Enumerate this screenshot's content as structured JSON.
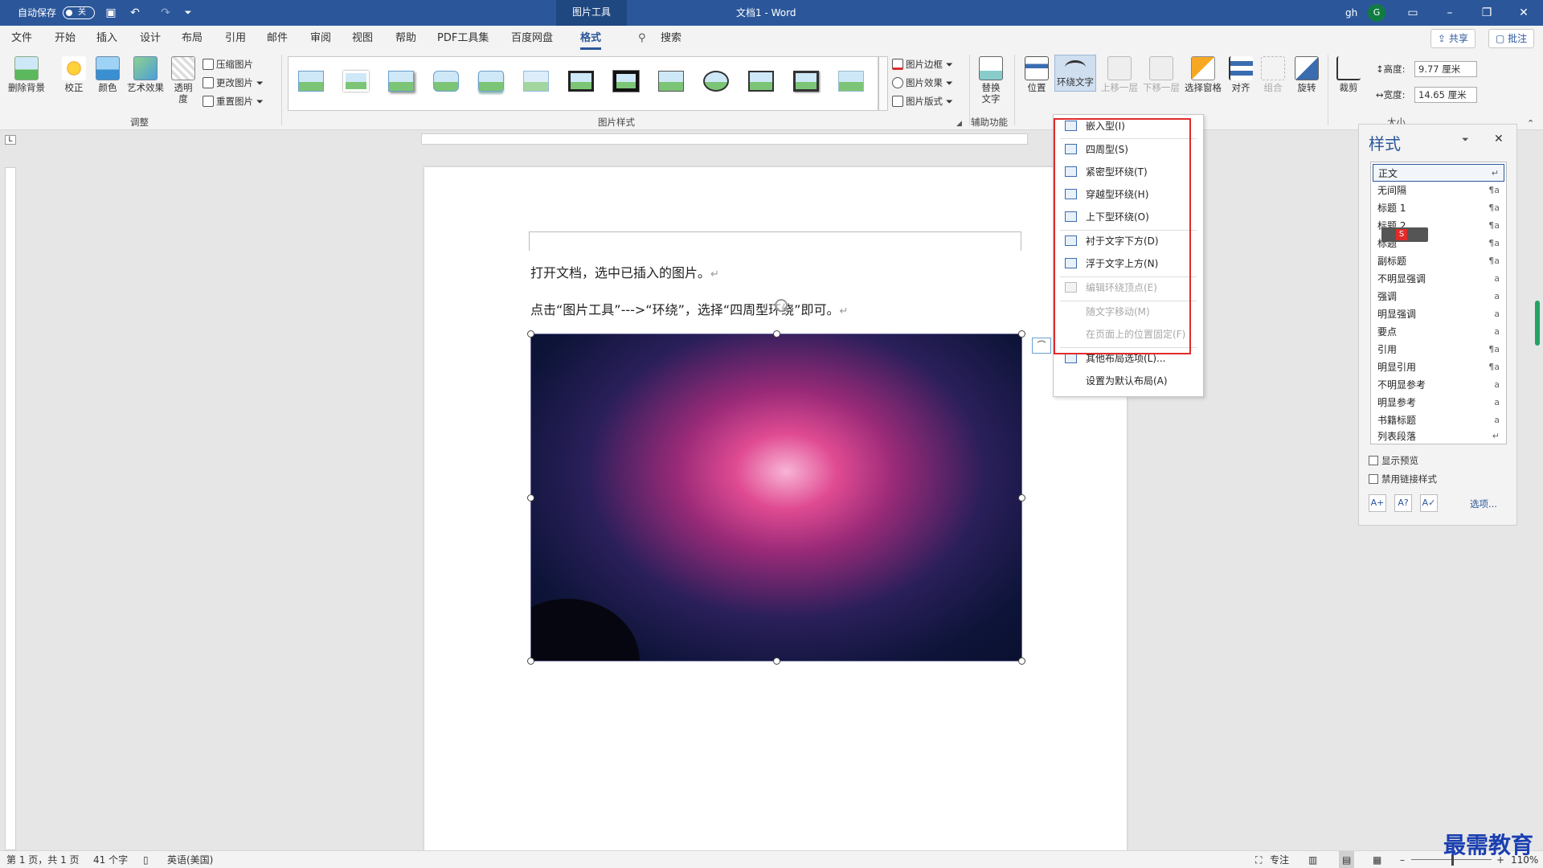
{
  "titlebar": {
    "autosave_label": "自动保存",
    "autosave_state": "关",
    "context_tab": "图片工具",
    "doc_title": "文档1  -  Word",
    "user_initials": "gh",
    "avatar_letter": "G",
    "window_controls": [
      "ribbon-display-icon",
      "minimize-icon",
      "restore-icon",
      "close-icon"
    ]
  },
  "menu": {
    "tabs": [
      "文件",
      "开始",
      "插入",
      "设计",
      "布局",
      "引用",
      "邮件",
      "审阅",
      "视图",
      "帮助",
      "PDF工具集",
      "百度网盘",
      "格式"
    ],
    "active_tab": "格式",
    "search_label": "搜索",
    "share_label": "共享",
    "comment_label": "批注"
  },
  "ribbon": {
    "remove_bg": "删除背景",
    "corrections": "校正",
    "color": "颜色",
    "artistic": "艺术效果",
    "transparency": "透明度",
    "compress": "压缩图片",
    "change_pic": "更改图片",
    "reset_pic": "重置图片",
    "group_adjust": "调整",
    "group_styles": "图片样式",
    "pic_border": "图片边框",
    "pic_effect": "图片效果",
    "pic_layout": "图片版式",
    "alt_text": "替换文字",
    "group_access": "辅助功能",
    "position": "位置",
    "wrap_text": "环绕文字",
    "bring_forward": "上移一层",
    "send_backward": "下移一层",
    "selection_pane": "选择窗格",
    "align": "对齐",
    "group": "组合",
    "rotate": "旋转",
    "crop": "裁剪",
    "height_label": "高度:",
    "height_value": "9.77 厘米",
    "width_label": "宽度:",
    "width_value": "14.65 厘米",
    "group_size": "大小"
  },
  "document": {
    "line1": "打开文档，选中已插入的图片。",
    "line2": "点击“图片工具”--->“环绕”，选择“四周型环绕”即可。",
    "return_mark": "↵"
  },
  "wrap_menu": {
    "items": [
      {
        "label": "嵌入型(I)",
        "disabled": false
      },
      {
        "label": "四周型(S)",
        "disabled": false
      },
      {
        "label": "紧密型环绕(T)",
        "disabled": false
      },
      {
        "label": "穿越型环绕(H)",
        "disabled": false
      },
      {
        "label": "上下型环绕(O)",
        "disabled": false
      },
      {
        "label": "衬于文字下方(D)",
        "disabled": false
      },
      {
        "label": "浮于文字上方(N)",
        "disabled": false
      },
      {
        "label": "编辑环绕顶点(E)",
        "disabled": true
      },
      {
        "label": "随文字移动(M)",
        "disabled": true
      },
      {
        "label": "在页面上的位置固定(F)",
        "disabled": true
      },
      {
        "label": "其他布局选项(L)...",
        "disabled": false
      },
      {
        "label": "设置为默认布局(A)",
        "disabled": false
      }
    ]
  },
  "styles_pane": {
    "title": "样式",
    "items": [
      {
        "label": "正文",
        "mark": "↵"
      },
      {
        "label": "无间隔",
        "mark": "¶a"
      },
      {
        "label": "标题 1",
        "mark": "¶a"
      },
      {
        "label": "标题 2",
        "mark": "¶a"
      },
      {
        "label": "标题",
        "mark": "¶a"
      },
      {
        "label": "副标题",
        "mark": "¶a"
      },
      {
        "label": "不明显强调",
        "mark": "a"
      },
      {
        "label": "强调",
        "mark": "a"
      },
      {
        "label": "明显强调",
        "mark": "a"
      },
      {
        "label": "要点",
        "mark": "a"
      },
      {
        "label": "引用",
        "mark": "¶a"
      },
      {
        "label": "明显引用",
        "mark": "¶a"
      },
      {
        "label": "不明显参考",
        "mark": "a"
      },
      {
        "label": "明显参考",
        "mark": "a"
      },
      {
        "label": "书籍标题",
        "mark": "a"
      },
      {
        "label": "列表段落",
        "mark": "↵"
      }
    ],
    "show_preview": "显示预览",
    "disable_linked": "禁用链接样式",
    "options": "选项..."
  },
  "status": {
    "page": "第 1 页，共 1 页",
    "words": "41 个字",
    "language": "英语(美国)",
    "focus": "专注",
    "zoom": "110%"
  },
  "watermark": "最需教育"
}
